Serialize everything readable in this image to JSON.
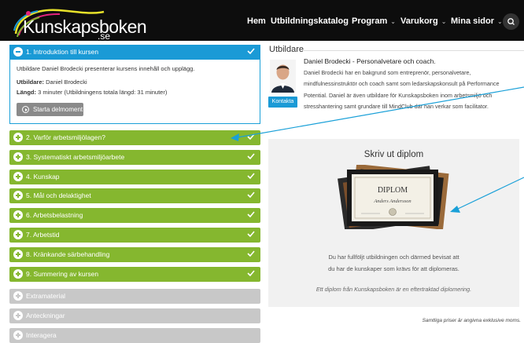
{
  "nav": {
    "logo_text": "Kunskapsboken",
    "logo_suffix": ".se",
    "items": [
      {
        "label": "Hem"
      },
      {
        "label": "Utbildningskatalog"
      },
      {
        "label": "Program",
        "chevron": "⌄"
      },
      {
        "label": "Varukorg",
        "chevron": "⌄"
      },
      {
        "label": "Mina sidor",
        "chevron": "⌄"
      }
    ]
  },
  "course": {
    "active_section": {
      "label": "1. Introduktion till kursen",
      "description": "Utbildare Daniel Brodecki presenterar kursens innehåll och upplägg.",
      "trainer_label": "Utbildare:",
      "trainer_value": "Daniel Brodecki",
      "length_label": "Längd:",
      "length_value": "3 minuter (Utbildningens totala längd: 31 minuter)",
      "start_button": "Starta delmoment"
    },
    "sections": [
      {
        "label": "2. Varför arbetsmiljölagen?"
      },
      {
        "label": "3. Systematiskt arbetsmiljöarbete"
      },
      {
        "label": "4. Kunskap"
      },
      {
        "label": "5. Mål och delaktighet"
      },
      {
        "label": "6. Arbetsbelastning"
      },
      {
        "label": "7. Arbetstid"
      },
      {
        "label": "8. Kränkande särbehandling"
      },
      {
        "label": "9. Summering av kursen"
      }
    ],
    "extras": [
      {
        "label": "Extramaterial"
      },
      {
        "label": "Anteckningar"
      },
      {
        "label": "Interagera"
      }
    ]
  },
  "trainer": {
    "section_title": "Utbildare",
    "name": "Daniel Brodecki - Personalvetare och coach.",
    "bio": "Daniel Brodecki har en bakgrund som entreprenör, personalvetare, mindfulnessinstruktör och coach samt som ledarskapskonsult på Performance Potential. Daniel är även utbildare för Kunskapsboken inom arbetsmiljö och stresshantering samt grundare till MindClub där han verkar som facilitator.",
    "contact_button": "Kontakta"
  },
  "diploma": {
    "title": "Skriv ut diplom",
    "image_word": "DIPLOM",
    "image_name": "Anders Andersson",
    "text_line1": "Du har fullföljt utbildningen och därmed bevisat att",
    "text_line2": "du har de kunskaper som krävs för att diplomeras.",
    "note": "Ett diplom från Kunskapsboken är en eftertraktad diplomering."
  },
  "footer": {
    "note": "Samtliga priser är angivna exklusive moms."
  },
  "colors": {
    "active": "#1a9ad6",
    "completed": "#85b72f",
    "locked": "#c8c8c8",
    "annotation_arrow": "#1aa0d8"
  }
}
